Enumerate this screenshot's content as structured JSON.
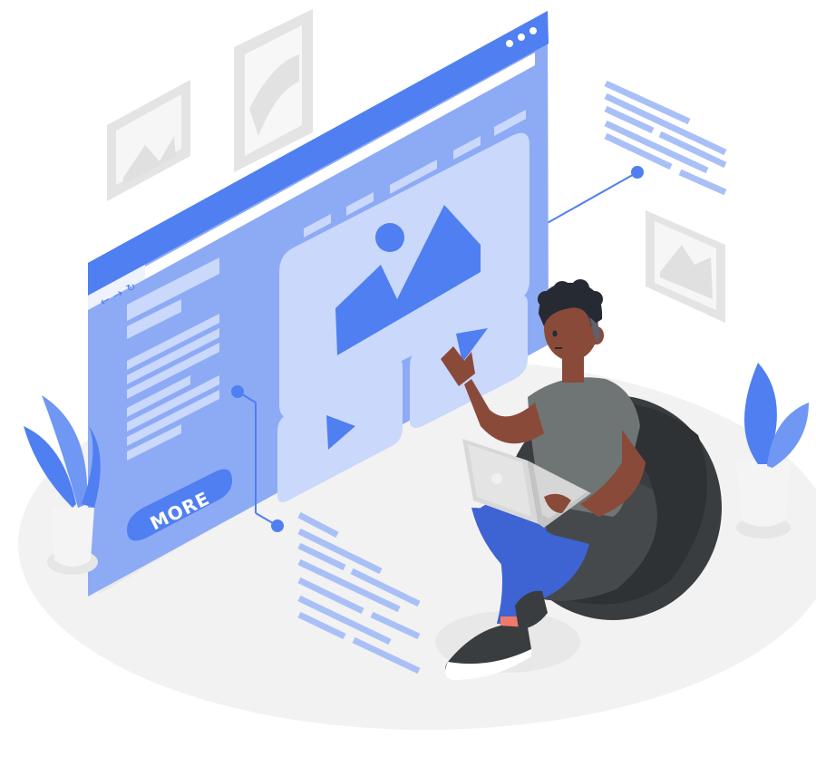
{
  "browser": {
    "more_button_label": "MORE",
    "nav_icons": [
      "back-arrow-icon",
      "forward-arrow-icon",
      "reload-icon"
    ],
    "window_controls": [
      "dot-icon",
      "dot-icon",
      "dot-icon"
    ]
  },
  "colors": {
    "primary_blue": "#4f7ff0",
    "light_blue": "#9bb8f6",
    "pale_blue": "#c9d8fb",
    "floor": "#f1f1f1",
    "frame_gray": "#e3e3e3",
    "beanbag": "#3a3d3f",
    "shirt": "#6e7574",
    "jeans": "#3e63d3",
    "skin": "#8a4a3a",
    "hair": "#262a33"
  }
}
